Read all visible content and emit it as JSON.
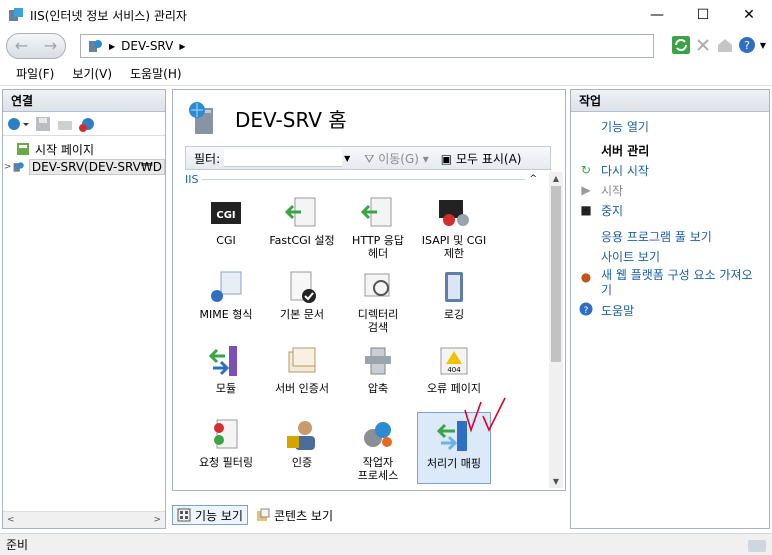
{
  "window": {
    "title": "IIS(인터넷 정보 서비스) 관리자",
    "minimize": "—",
    "maximize": "☐",
    "close": "✕"
  },
  "address": {
    "crumb": "DEV-SRV"
  },
  "menu": [
    "파일(F)",
    "보기(V)",
    "도움말(H)"
  ],
  "connections": {
    "header": "연결",
    "tree": [
      {
        "label": "시작 페이지"
      },
      {
        "label": "DEV-SRV(DEV-SRV₩D"
      }
    ]
  },
  "center": {
    "title": "DEV-SRV 홈",
    "filter": {
      "label": "필터:",
      "go": "이동(G)",
      "show_all": "모두 표시(A)"
    },
    "group": "IIS",
    "tiles": [
      {
        "label": "CGI",
        "icon": "cgi-icon"
      },
      {
        "label": "FastCGI 설정",
        "icon": "fastcgi-icon"
      },
      {
        "label": "HTTP 응답\n헤더",
        "icon": "http-headers-icon"
      },
      {
        "label": "ISAPI 및 CGI\n제한",
        "icon": "isapi-cgi-icon"
      },
      {
        "label": "MIME 형식",
        "icon": "mime-icon"
      },
      {
        "label": "기본 문서",
        "icon": "default-doc-icon"
      },
      {
        "label": "디렉터리\n검색",
        "icon": "dir-browse-icon"
      },
      {
        "label": "로깅",
        "icon": "logging-icon"
      },
      {
        "label": "모듈",
        "icon": "modules-icon"
      },
      {
        "label": "서버 인증서",
        "icon": "cert-icon"
      },
      {
        "label": "압축",
        "icon": "compression-icon"
      },
      {
        "label": "오류 페이지",
        "icon": "error-page-icon"
      },
      {
        "label": "요청 필터링",
        "icon": "request-filter-icon"
      },
      {
        "label": "인증",
        "icon": "auth-icon"
      },
      {
        "label": "작업자\n프로세스",
        "icon": "worker-process-icon"
      },
      {
        "label": "처리기 매핑",
        "icon": "handler-mapping-icon"
      }
    ],
    "tabs": {
      "features": "기능 보기",
      "content": "콘텐츠 보기"
    }
  },
  "actions": {
    "header": "작업",
    "open_feature": "기능 열기",
    "manage_server": "서버 관리",
    "restart": "다시 시작",
    "start": "시작",
    "stop": "중지",
    "view_pools": "응용 프로그램 풀 보기",
    "view_sites": "사이트 보기",
    "get_components": "새 웹 플랫폼 구성 요소 가져오기",
    "help": "도움말"
  },
  "status": {
    "text": "준비"
  }
}
